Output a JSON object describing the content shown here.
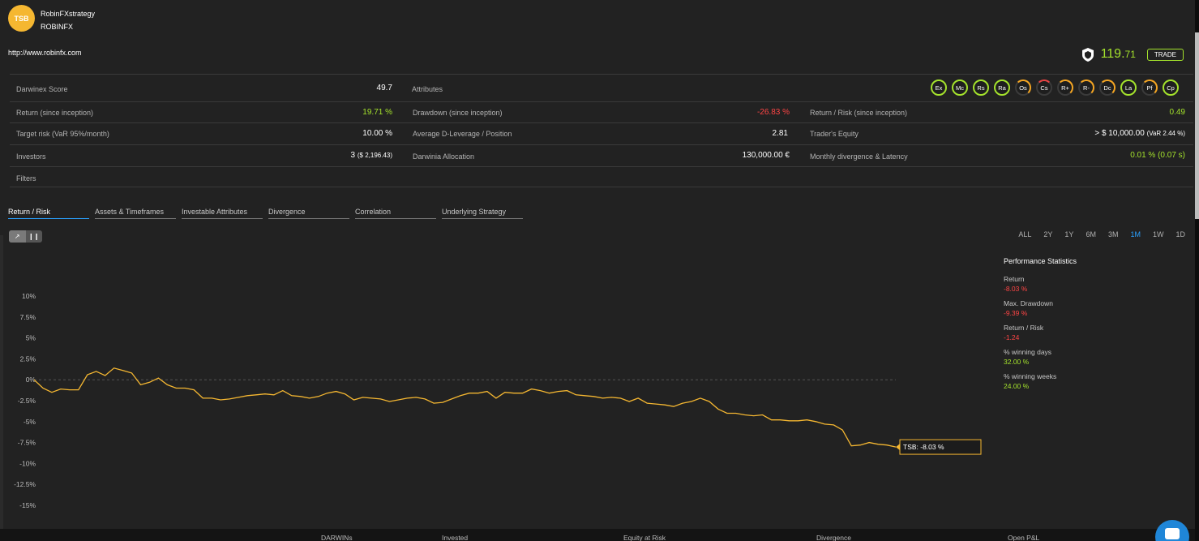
{
  "header": {
    "avatar_text": "TSB",
    "strategy_name": "RobinFXstrategy",
    "strategy_code": "ROBINFX",
    "website": "http://www.robinfx.com",
    "price_int": "119.",
    "price_dec": "71",
    "trade_label": "TRADE"
  },
  "stats": {
    "darwinex_score_label": "Darwinex Score",
    "darwinex_score_value": "49.7",
    "attributes_label": "Attributes",
    "attributes": [
      {
        "code": "Ex",
        "ring": "g"
      },
      {
        "code": "Mc",
        "ring": "g"
      },
      {
        "code": "Rs",
        "ring": "g"
      },
      {
        "code": "Ra",
        "ring": "g"
      },
      {
        "code": "Os",
        "ring": "o"
      },
      {
        "code": "Cs",
        "ring": "r"
      },
      {
        "code": "R+",
        "ring": "o"
      },
      {
        "code": "R-",
        "ring": "o"
      },
      {
        "code": "Dc",
        "ring": "o"
      },
      {
        "code": "La",
        "ring": "g"
      },
      {
        "code": "Pf",
        "ring": "o"
      },
      {
        "code": "Cp",
        "ring": "g"
      }
    ],
    "return_label": "Return (since inception)",
    "return_value": "19.71 %",
    "drawdown_label": "Drawdown (since inception)",
    "drawdown_value": "-26.83 %",
    "return_risk_label": "Return / Risk (since inception)",
    "return_risk_value": "0.49",
    "target_risk_label": "Target risk (VaR 95%/month)",
    "target_risk_value": "10.00 %",
    "avg_leverage_label": "Average D-Leverage / Position",
    "avg_leverage_value": "2.81",
    "equity_label": "Trader's Equity",
    "equity_value": "> $ 10,000.00",
    "equity_sub": "(VaR 2.44 %)",
    "investors_label": "Investors",
    "investors_value": "3",
    "investors_sub": "($ 2,196.43)",
    "allocation_label": "Darwinia Allocation",
    "allocation_value": "130,000.00 €",
    "divergence_label": "Monthly divergence & Latency",
    "divergence_value": "0.01 % (0.07 s)",
    "filters_label": "Filters"
  },
  "tabs": [
    {
      "label": "Return / Risk",
      "active": true
    },
    {
      "label": "Assets & Timeframes",
      "active": false
    },
    {
      "label": "Investable Attributes",
      "active": false
    },
    {
      "label": "Divergence",
      "active": false
    },
    {
      "label": "Correlation",
      "active": false
    },
    {
      "label": "Underlying Strategy",
      "active": false
    }
  ],
  "ranges": [
    {
      "label": "ALL",
      "active": false
    },
    {
      "label": "2Y",
      "active": false
    },
    {
      "label": "1Y",
      "active": false
    },
    {
      "label": "6M",
      "active": false
    },
    {
      "label": "3M",
      "active": false
    },
    {
      "label": "1M",
      "active": true
    },
    {
      "label": "1W",
      "active": false
    },
    {
      "label": "1D",
      "active": false
    }
  ],
  "performance": {
    "title": "Performance Statistics",
    "items": [
      {
        "label": "Return",
        "value": "-8.03 %",
        "tone": "red"
      },
      {
        "label": "Max. Drawdown",
        "value": "-9.39 %",
        "tone": "red"
      },
      {
        "label": "Return / Risk",
        "value": "-1.24",
        "tone": "red"
      },
      {
        "label": "% winning days",
        "value": "32.00 %",
        "tone": "green"
      },
      {
        "label": "% winning weeks",
        "value": "24.00 %",
        "tone": "green"
      }
    ]
  },
  "bottom_labels": [
    "DARWINs",
    "Invested",
    "Equity at Risk",
    "Divergence",
    "Open P&L"
  ],
  "chart_data": {
    "type": "line",
    "y_ticks": [
      "10%",
      "7.5%",
      "5%",
      "2.5%",
      "0%",
      "-2.5%",
      "-5%",
      "-7.5%",
      "-10%",
      "-12.5%",
      "-15%"
    ],
    "ylim": [
      -15,
      10
    ],
    "series": [
      {
        "name": "TSB",
        "color": "#f5b731",
        "values": [
          0,
          -1,
          -1.5,
          -1.1,
          -1.2,
          -1.2,
          0.6,
          1,
          0.5,
          1.4,
          1.1,
          0.8,
          -0.6,
          -0.3,
          0.2,
          -0.6,
          -1,
          -1,
          -1.2,
          -2.2,
          -2.2,
          -2.4,
          -2.3,
          -2.1,
          -1.9,
          -1.8,
          -1.7,
          -1.8,
          -1.3,
          -1.9,
          -2,
          -2.2,
          -2,
          -1.6,
          -1.4,
          -1.7,
          -2.4,
          -2.1,
          -2.2,
          -2.3,
          -2.6,
          -2.4,
          -2.2,
          -2.1,
          -2.3,
          -2.8,
          -2.7,
          -2.3,
          -1.9,
          -1.6,
          -1.6,
          -1.4,
          -2.2,
          -1.5,
          -1.6,
          -1.6,
          -1.1,
          -1.3,
          -1.6,
          -1.4,
          -1.3,
          -1.8,
          -1.9,
          -2,
          -2.2,
          -2.1,
          -2.2,
          -2.6,
          -2.2,
          -2.8,
          -2.9,
          -3,
          -3.2,
          -2.8,
          -2.6,
          -2.2,
          -2.6,
          -3.5,
          -4,
          -4,
          -4.2,
          -4.3,
          -4.2,
          -4.8,
          -4.8,
          -4.9,
          -4.9,
          -4.8,
          -5,
          -5.3,
          -5.4,
          -6,
          -7.9,
          -7.8,
          -7.5,
          -7.7,
          -7.8,
          -8.03
        ],
        "label": "TSB: -8.03 %"
      }
    ]
  }
}
